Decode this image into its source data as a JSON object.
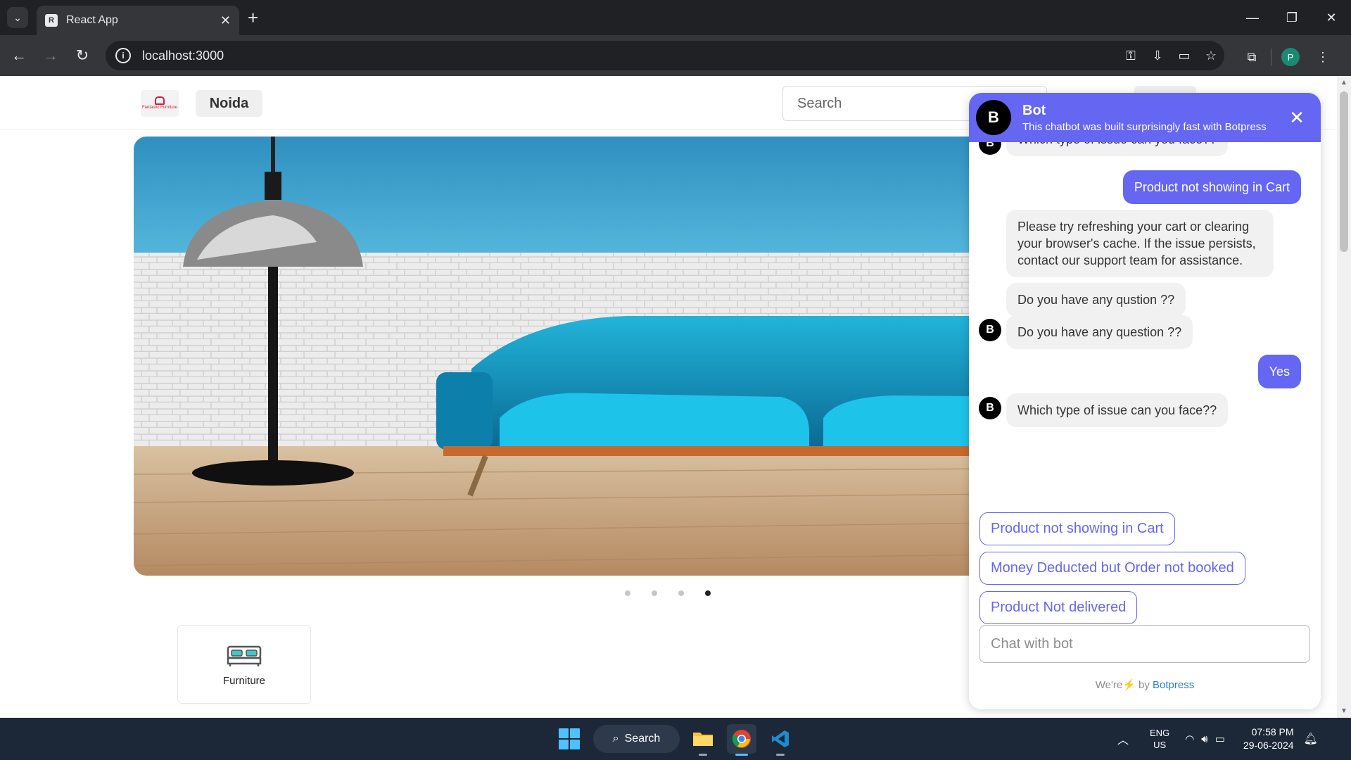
{
  "browser": {
    "tab_title": "React App",
    "tab_favicon": "R",
    "url": "localhost:3000",
    "profile_initial": "P",
    "icons": [
      "tab-search-icon",
      "close-tab-icon",
      "new-tab-icon",
      "minimize-icon",
      "restore-icon",
      "close-window-icon",
      "back-icon",
      "forward-icon",
      "reload-icon",
      "site-info-icon",
      "password-key-icon",
      "install-app-icon",
      "payment-card-icon",
      "bookmark-star-icon",
      "extensions-icon",
      "menu-kebab-icon"
    ]
  },
  "site": {
    "logo_text": "Fantastic Furniture",
    "location": "Noida",
    "search_placeholder": "Search",
    "carousel": {
      "slide_count": 4,
      "active_index": 3
    },
    "categories": [
      {
        "label": "Furniture",
        "icon": "bed-icon"
      }
    ]
  },
  "chat": {
    "bot_initial": "B",
    "bot_name": "Bot",
    "bot_description": "This chatbot was built surprisingly fast with Botpress",
    "messages": {
      "m0": "Which type of issue can you face??",
      "m1": "Product not showing in Cart",
      "m2": "Please try refreshing your cart or clearing your browser's cache. If the issue persists, contact our support team for assistance.",
      "m3": "Do you have any qustion ??",
      "m4": "Do you have any question ??",
      "m5": "Yes",
      "m6": "Which type of issue can you face??"
    },
    "choices": {
      "c0": "Product not showing in Cart",
      "c1": "Money Deducted but Order not booked",
      "c2": "Product Not delivered"
    },
    "input_placeholder": "Chat with bot",
    "powered_prefix": "We're",
    "powered_by": "by",
    "powered_brand": "Botpress",
    "accent_color": "#6566f1"
  },
  "taskbar": {
    "search_label": "Search",
    "apps": [
      "file-explorer-icon",
      "chrome-icon",
      "vscode-icon"
    ],
    "lang_line1": "ENG",
    "lang_line2": "US",
    "time": "07:58 PM",
    "date": "29-06-2024"
  }
}
